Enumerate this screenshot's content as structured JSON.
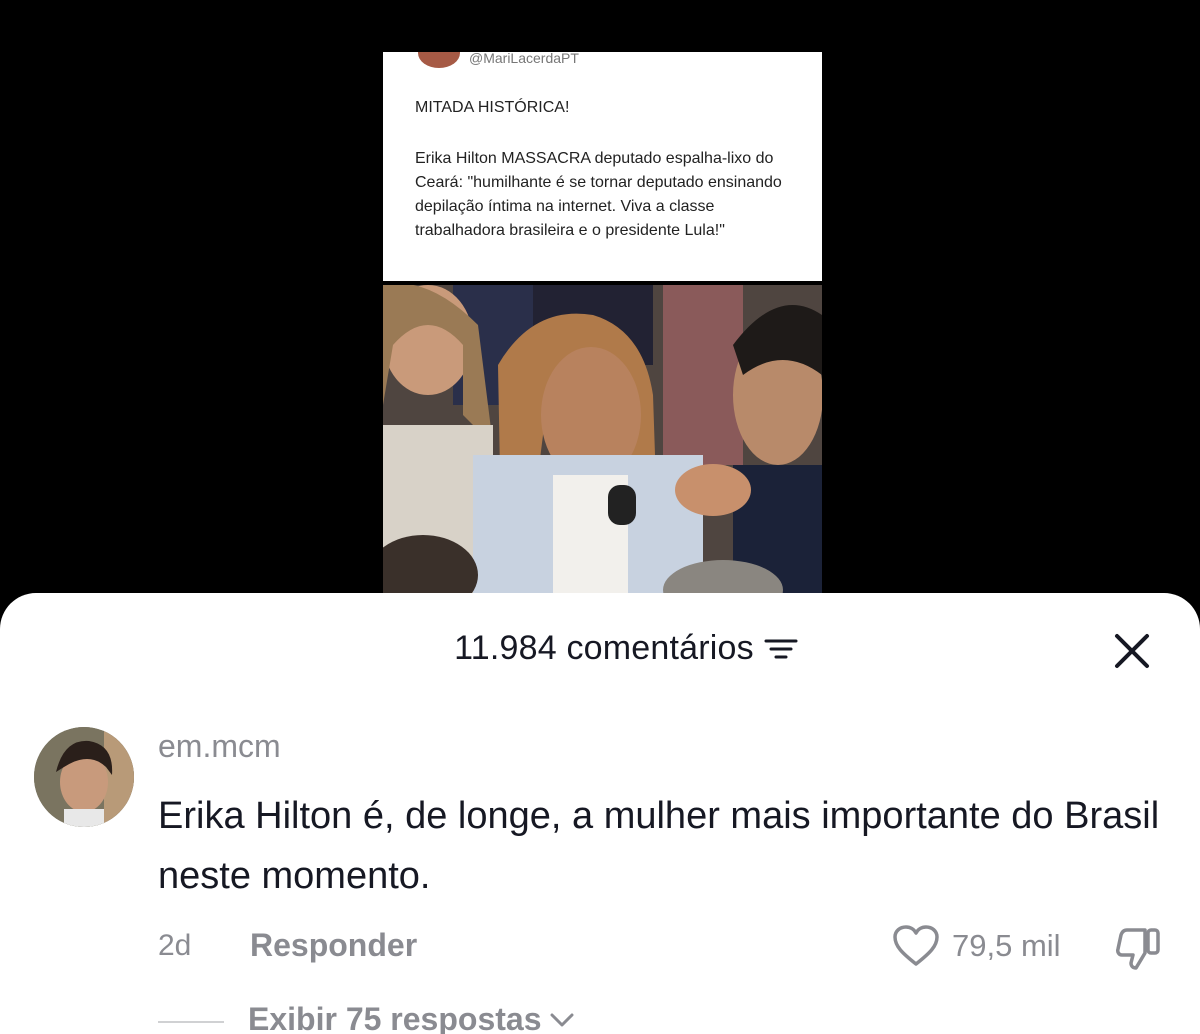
{
  "video": {
    "tweet": {
      "handle": "@MariLacerdaPT",
      "headline": "MITADA HISTÓRICA!",
      "body": "Erika Hilton MASSACRA deputado espalha-lixo do Ceará: \"humilhante é se tornar deputado ensinando depilação íntima na internet. Viva a classe trabalhadora brasileira e o presidente Lula!\""
    }
  },
  "comments_panel": {
    "count_label": "11.984 comentários",
    "sort_icon": "filter-lines-icon",
    "close_icon": "close-icon",
    "comment": {
      "username": "em.mcm",
      "text": "Erika Hilton é, de longe, a mulher mais importante do Brasil neste momento.",
      "time": "2d",
      "reply_label": "Responder",
      "likes": "79,5 mil",
      "like_icon": "heart-outline-icon",
      "dislike_icon": "thumbs-down-icon",
      "view_replies_label": "Exibir 75 respostas"
    }
  },
  "colors": {
    "primary_text": "#161823",
    "secondary_text": "#8a8b91",
    "sheet_bg": "#ffffff",
    "video_bg": "#000000"
  }
}
